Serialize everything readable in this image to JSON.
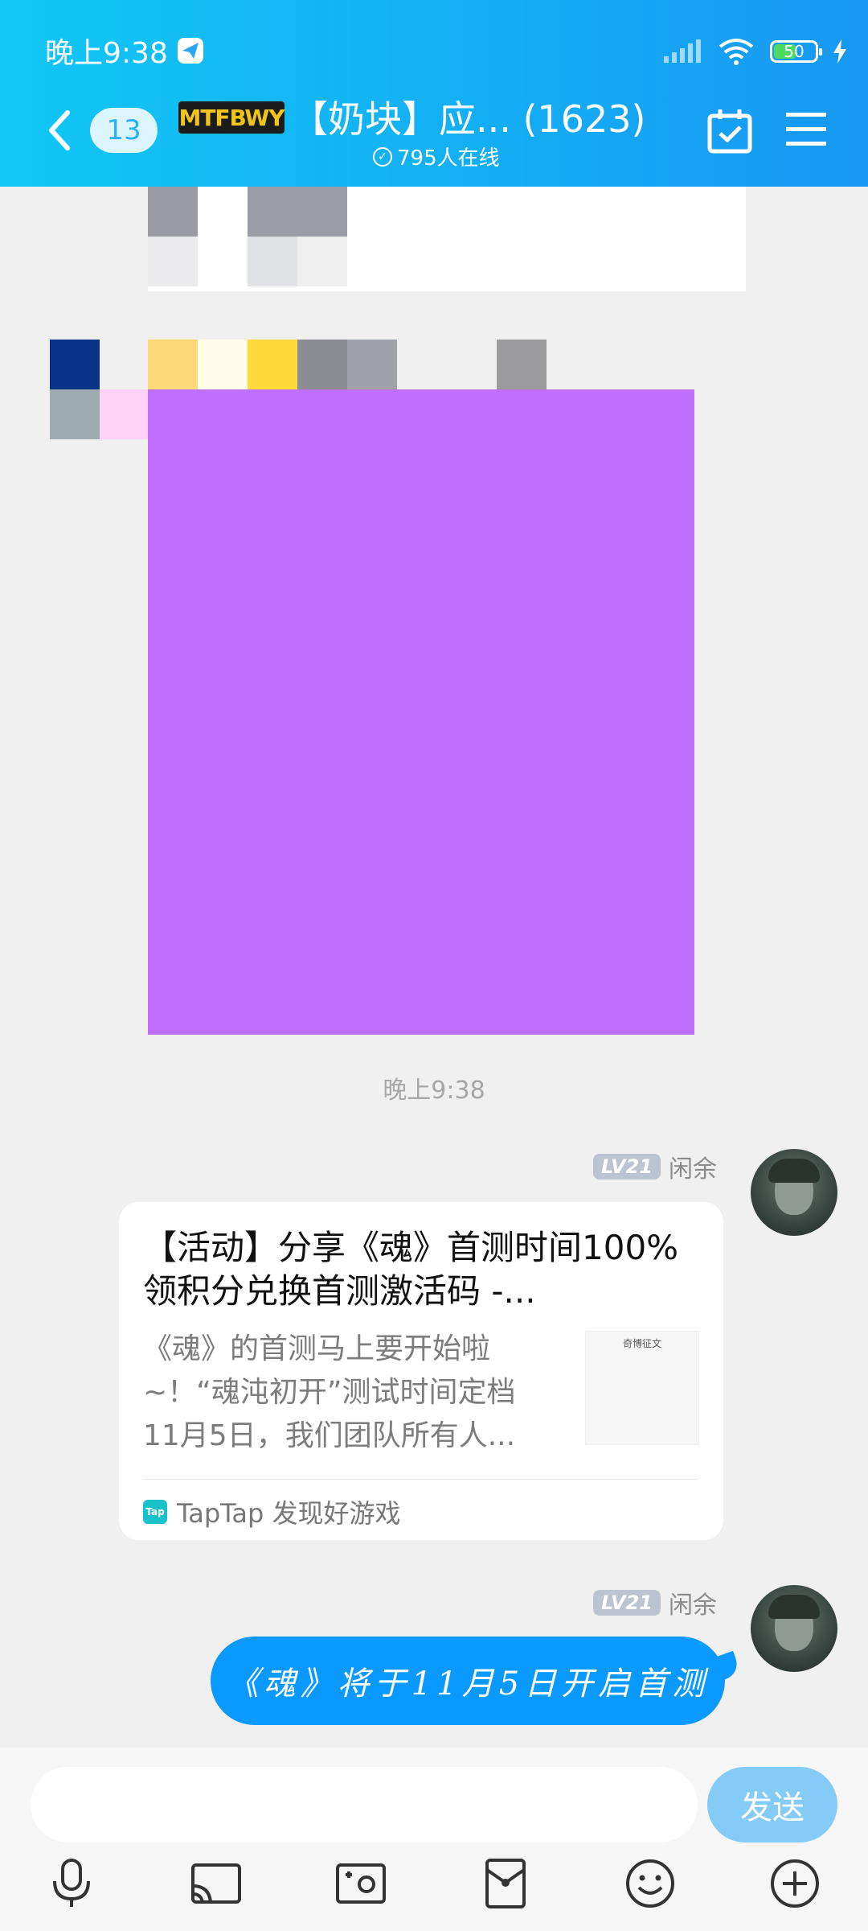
{
  "status_bar": {
    "time": "晚上9:38",
    "battery": "50"
  },
  "header": {
    "unread_count": "13",
    "group_logo": "MTFBWY",
    "title": "【奶块】应... (1623)",
    "online": "795人在线"
  },
  "chat": {
    "timestamp": "晚上9:38",
    "messages": [
      {
        "sender": "闲余",
        "level": "LV21",
        "type": "share",
        "title": "【活动】分享《魂》首测时间100%领积分兑换首测激活码 -...",
        "description": "《魂》的首测马上要开始啦~！“魂沌初开”测试时间定档11月5日，我们团队所有人...",
        "thumb_caption": "奇博征文",
        "source": "TapTap 发现好游戏",
        "source_icon": "Tap"
      },
      {
        "sender": "闲余",
        "level": "LV21",
        "type": "text",
        "text": "《魂》将于11月5日开启首测"
      }
    ]
  },
  "input_bar": {
    "placeholder": "",
    "send_label": "发送"
  },
  "toolbar": {
    "icons": [
      "microphone-icon",
      "screen-cast-icon",
      "photo-icon",
      "red-packet-icon",
      "emoji-icon",
      "plus-icon"
    ]
  },
  "colors": {
    "header_gradient_start": "#12c7f5",
    "header_gradient_end": "#1798f2",
    "bubble": "#0a99ff",
    "send_button": "#84cbf7",
    "purple_image": "#bf6ffb"
  }
}
